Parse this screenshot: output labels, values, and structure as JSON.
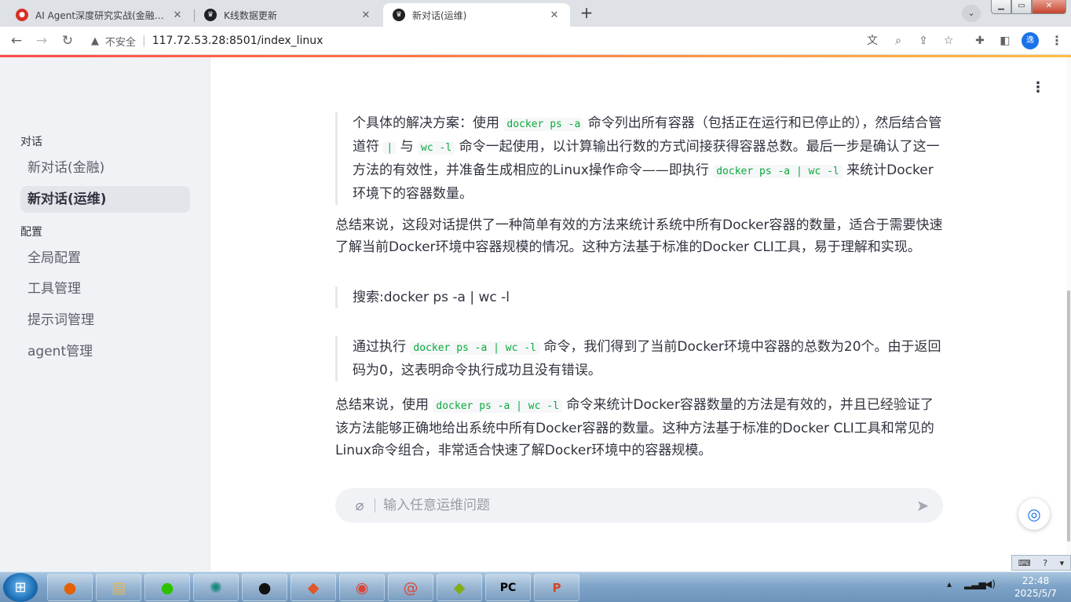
{
  "browser": {
    "tabs": [
      {
        "title": "AI Agent深度研究实战(金融版) - ",
        "favicon": "red-app-icon"
      },
      {
        "title": "K线数据更新",
        "favicon": "crown-icon"
      },
      {
        "title": "新对话(运维)",
        "favicon": "crown-icon"
      }
    ],
    "newtab": "+",
    "security": "不安全",
    "url": "117.72.53.28:8501/index_linux",
    "profile": "逸"
  },
  "sidebar": {
    "section_chat": "对话",
    "chat_items": [
      {
        "label": "新对话(金融)"
      },
      {
        "label": "新对话(运维)"
      }
    ],
    "section_config": "配置",
    "config_items": [
      {
        "label": "全局配置"
      },
      {
        "label": "工具管理"
      },
      {
        "label": "提示词管理"
      },
      {
        "label": "agent管理"
      }
    ]
  },
  "messages": {
    "bq1": {
      "t1": "个具体的解决方案：使用",
      "c1": "docker ps -a",
      "t2": "命令列出所有容器（包括正在运行和已停止的），然后结合管道符",
      "c2": "|",
      "t3": "与",
      "c3": "wc -l",
      "t4": "命令一起使用，以计算输出行数的方式间接获得容器总数。最后一步是确认了这一方法的有效性，并准备生成相应的Linux操作命令——即执行",
      "c4": "docker ps -a | wc -l",
      "t5": "来统计Docker环境下的容器数量。"
    },
    "summary1": "总结来说，这段对话提供了一种简单有效的方法来统计系统中所有Docker容器的数量，适合于需要快速了解当前Docker环境中容器规模的情况。这种方法基于标准的Docker CLI工具，易于理解和实现。",
    "search": "搜索:docker ps -a | wc -l",
    "result": {
      "t1": "通过执行",
      "c1": "docker ps -a | wc -l",
      "t2": "命令，我们得到了当前Docker环境中容器的总数为20个。由于返回码为0，这表明命令执行成功且没有错误。"
    },
    "summary2": {
      "t1": "总结来说，使用",
      "c1": "docker ps -a | wc -l",
      "t2": "命令来统计Docker容器数量的方法是有效的，并且已经验证了该方法能够正确地给出系统中所有Docker容器的数量。这种方法基于标准的Docker CLI工具和常见的Linux命令组合，非常适合快速了解Docker环境中的容器规模。"
    }
  },
  "chat_input": {
    "placeholder": "输入任意运维问题"
  },
  "taskbar": {
    "time": "22:48",
    "date": "2025/5/7"
  }
}
